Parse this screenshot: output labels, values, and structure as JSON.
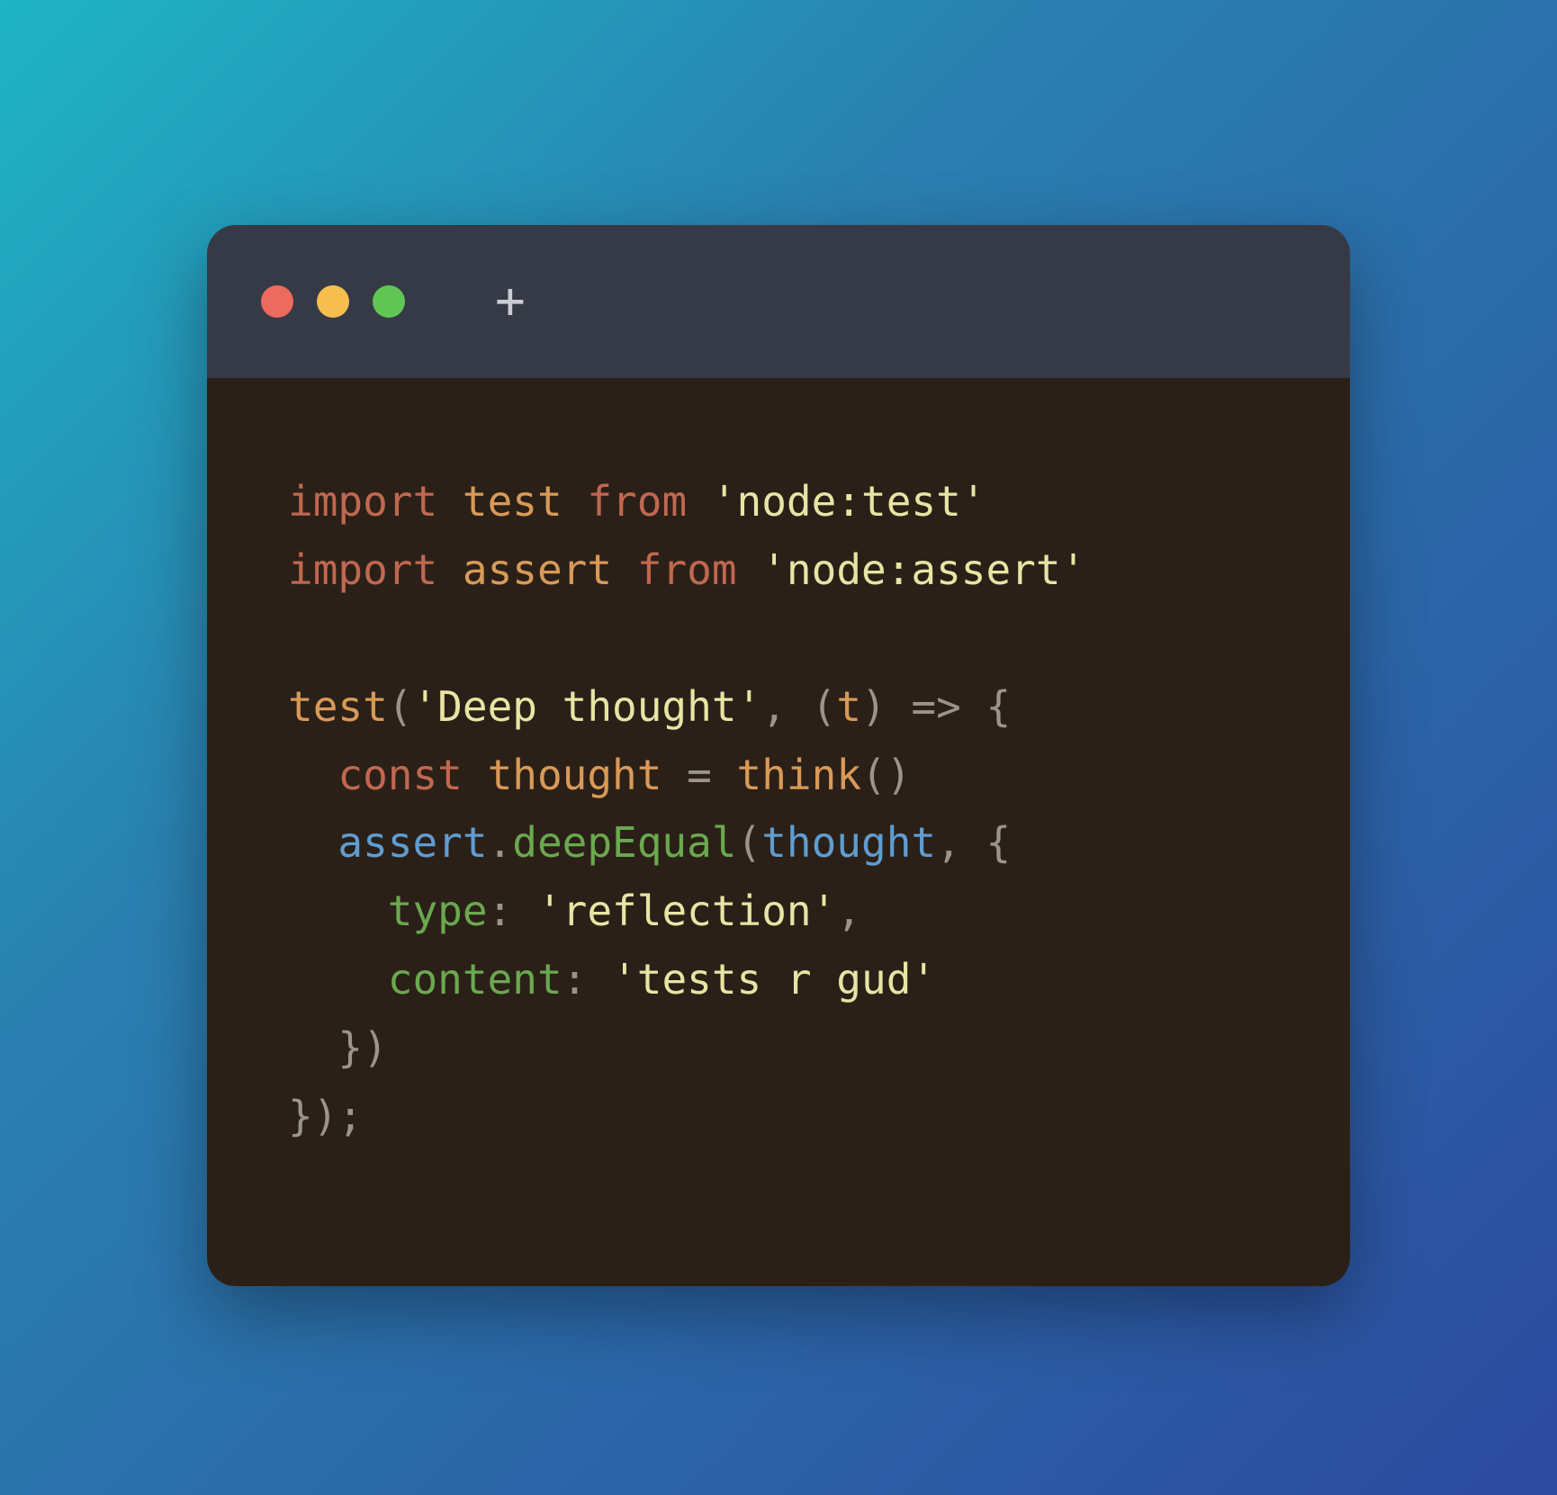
{
  "window": {
    "traffic_lights": {
      "red": "#ed6a5e",
      "yellow": "#f5be4f",
      "green": "#61c554"
    },
    "new_tab_icon": "plus-icon"
  },
  "code": {
    "line1": {
      "kw1": "import",
      "ident": "test",
      "kw2": "from",
      "str": "'node:test'"
    },
    "line2": {
      "kw1": "import",
      "ident": "assert",
      "kw2": "from",
      "str": "'node:assert'"
    },
    "line3": "",
    "line4": {
      "call": "test",
      "open": "(",
      "str": "'Deep thought'",
      "comma": ",",
      "sp": " ",
      "lpar": "(",
      "param": "t",
      "rpar": ")",
      "arrow": " => ",
      "brace": "{"
    },
    "line5": {
      "indent": "  ",
      "kw": "const",
      "ident": "thought",
      "eq": " = ",
      "call": "think",
      "parens": "()"
    },
    "line6": {
      "indent": "  ",
      "obj": "assert",
      "dot": ".",
      "method": "deepEqual",
      "open": "(",
      "arg": "thought",
      "comma": ",",
      "sp": " ",
      "brace": "{"
    },
    "line7": {
      "indent": "    ",
      "key": "type",
      "colon": ":",
      "sp": " ",
      "val": "'reflection'",
      "comma": ","
    },
    "line8": {
      "indent": "    ",
      "key": "content",
      "colon": ":",
      "sp": " ",
      "val": "'tests r gud'"
    },
    "line9": {
      "indent": "  ",
      "close": "})"
    },
    "line10": {
      "close": "});"
    }
  }
}
